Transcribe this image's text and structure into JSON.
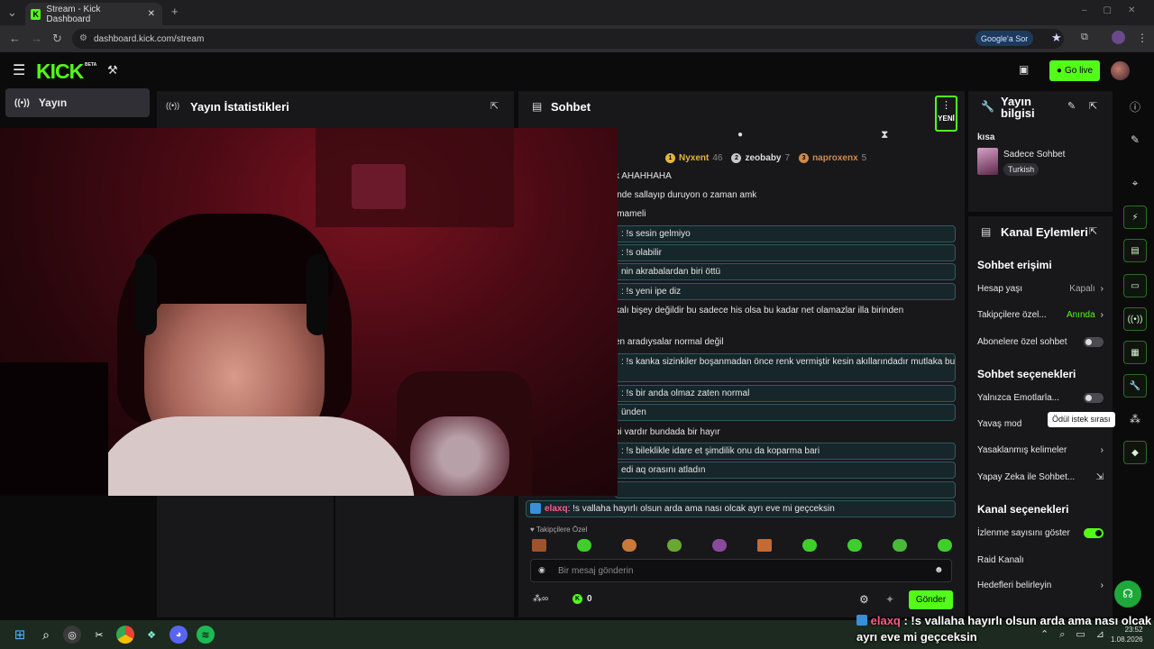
{
  "browser": {
    "tab_title": "Stream - Kick Dashboard",
    "url": "dashboard.kick.com/stream",
    "google_label": "Google'a Sor"
  },
  "header": {
    "logo": "KICK",
    "beta": "BETA",
    "go_live": "Go live"
  },
  "left_nav": {
    "items": [
      {
        "label": "Yayın"
      }
    ]
  },
  "stats_panel": {
    "title": "Yayın İstatistikleri"
  },
  "chat_panel": {
    "title": "Sohbet",
    "new_badge": "YENİ",
    "leaderboard": [
      {
        "rank": "1",
        "name": "Nyxent",
        "count": "46",
        "color": "#e3b53a"
      },
      {
        "rank": "2",
        "name": "zeobaby",
        "count": "7",
        "color": "#c8c8c8"
      },
      {
        "rank": "3",
        "name": "naproxenx",
        "count": "5",
        "color": "#d08a4a"
      }
    ],
    "messages": [
      {
        "text": "k AHAHHAHA",
        "boxed": false
      },
      {
        "text": "inde sallayıp duruyon o zaman amk",
        "boxed": false
      },
      {
        "text": "imameli",
        "boxed": false
      },
      {
        "text": ": !s sesin gelmiyo",
        "boxed": true
      },
      {
        "text": ": !s olabilir",
        "boxed": true
      },
      {
        "text": "nin akrabalardan biri öttü",
        "boxed": true
      },
      {
        "text": ": !s yeni ipe diz",
        "boxed": true
      },
      {
        "text": "kalı bişey değildir bu sadece his olsa bu kadar net olamazlar illa birinden",
        "boxed": false
      },
      {
        "text": "en aradıysalar normal değil",
        "boxed": false
      },
      {
        "text": ": !s kanka sizinkiler boşanmadan önce renk vermiştir kesin akıllarındadır mutlaka bu",
        "boxed": true
      },
      {
        "text": ": !s bir anda olmaz zaten normal",
        "boxed": true
      },
      {
        "text": "ünden",
        "boxed": true
      },
      {
        "text": "bi vardır bundada bir hayır",
        "boxed": false
      },
      {
        "text": ": !s bileklikle idare et şimdilik onu da koparma bari",
        "boxed": true
      },
      {
        "text": "edi aq orasını atladın",
        "boxed": true
      }
    ],
    "last_user": "elaxq",
    "last_text": ": !s vallaha hayırlı olsun arda ama nası olcak ayrı eve mi geçceksin",
    "emote_label": "Takipçilere Özel",
    "input_placeholder": "Bir mesaj gönderin",
    "points": "0",
    "send": "Gönder"
  },
  "info_panel": {
    "title": "Yayın bilgisi",
    "stream_title": "kısa",
    "category": "Sadece Sohbet",
    "tag": "Turkish"
  },
  "actions_panel": {
    "title": "Kanal Eylemleri",
    "sections": [
      {
        "heading": "Sohbet erişimi"
      },
      {
        "heading": "Sohbet seçenekleri"
      },
      {
        "heading": "Kanal seçenekleri"
      }
    ],
    "rows": {
      "age": {
        "label": "Hesap yaşı",
        "value": "Kapalı"
      },
      "followers": {
        "label": "Takipçilere özel...",
        "value": "Anında"
      },
      "subs": {
        "label": "Abonelere özel sohbet"
      },
      "emotes": {
        "label": "Yalnızca Emotlarla..."
      },
      "slow": {
        "label": "Yavaş mod"
      },
      "banned": {
        "label": "Yasaklanmış kelimeler"
      },
      "ai": {
        "label": "Yapay Zeka ile Sohbet..."
      },
      "viewers": {
        "label": "İzlenme sayısını göster"
      },
      "raid": {
        "label": "Raid Kanalı"
      },
      "goals": {
        "label": "Hedefleri belirleyin"
      }
    },
    "tooltip": "Ödül istek sırası"
  },
  "overlay": {
    "user": "elaxq",
    "text": " : !s vallaha hayırlı olsun arda ama nası olcak ayrı eve mi geçceksin"
  },
  "taskbar": {
    "time": "23:52",
    "date": "1.08.2026"
  },
  "colors": {
    "brand": "#53fc18",
    "panel": "#18181b",
    "background": "#0b0b0c"
  }
}
